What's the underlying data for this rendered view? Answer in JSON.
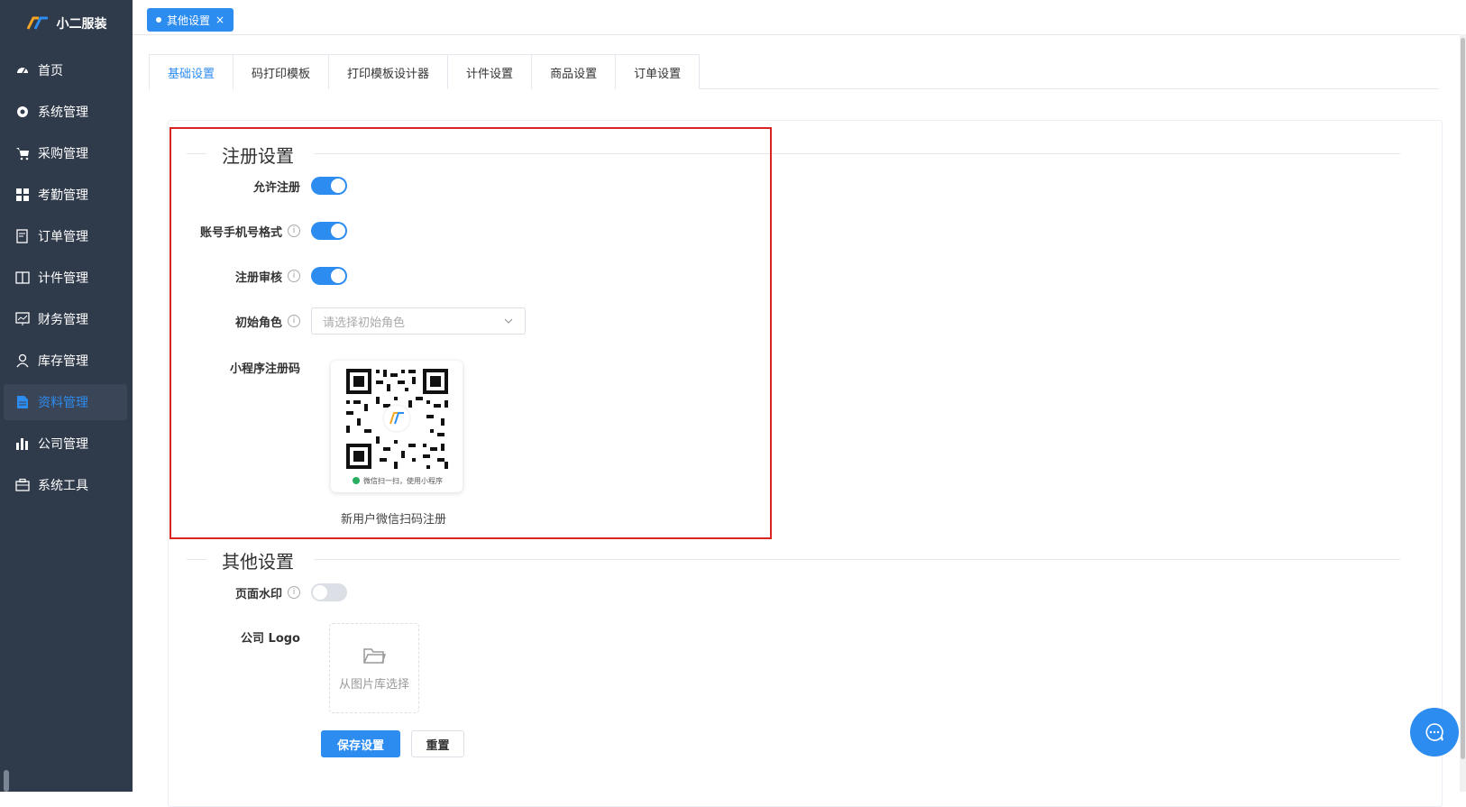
{
  "app": {
    "name": "小二服装"
  },
  "sidebar": {
    "items": [
      {
        "label": "首页",
        "icon": "dashboard-icon"
      },
      {
        "label": "系统管理",
        "icon": "gear-icon"
      },
      {
        "label": "采购管理",
        "icon": "cart-icon"
      },
      {
        "label": "考勤管理",
        "icon": "grid-icon"
      },
      {
        "label": "订单管理",
        "icon": "order-icon"
      },
      {
        "label": "计件管理",
        "icon": "book-icon"
      },
      {
        "label": "财务管理",
        "icon": "chart-board-icon"
      },
      {
        "label": "库存管理",
        "icon": "user-icon"
      },
      {
        "label": "资料管理",
        "icon": "document-icon",
        "active": true
      },
      {
        "label": "公司管理",
        "icon": "bar-chart-icon"
      },
      {
        "label": "系统工具",
        "icon": "toolbox-icon"
      }
    ]
  },
  "topbar": {
    "tag_label": "其他设置",
    "tag_close": "×"
  },
  "tabs": [
    {
      "label": "基础设置",
      "active": true
    },
    {
      "label": "码打印模板"
    },
    {
      "label": "打印模板设计器"
    },
    {
      "label": "计件设置"
    },
    {
      "label": "商品设置"
    },
    {
      "label": "订单设置"
    }
  ],
  "registration": {
    "title": "注册设置",
    "allow_label": "允许注册",
    "allow_value": true,
    "phone_format_label": "账号手机号格式",
    "phone_format_value": true,
    "review_label": "注册审核",
    "review_value": true,
    "role_label": "初始角色",
    "role_placeholder": "请选择初始角色",
    "qrcode_label": "小程序注册码",
    "qrcode_footer": "微信扫一扫，使用小程序",
    "qrcode_caption": "新用户微信扫码注册"
  },
  "other": {
    "title": "其他设置",
    "watermark_label": "页面水印",
    "watermark_value": false,
    "logo_label": "公司 Logo",
    "logo_upload_text": "从图片库选择"
  },
  "actions": {
    "save_label": "保存设置",
    "reset_label": "重置"
  },
  "colors": {
    "sidebar_bg": "#2f3a4b",
    "accent": "#2d8cf0",
    "highlight": "#d9251f"
  }
}
